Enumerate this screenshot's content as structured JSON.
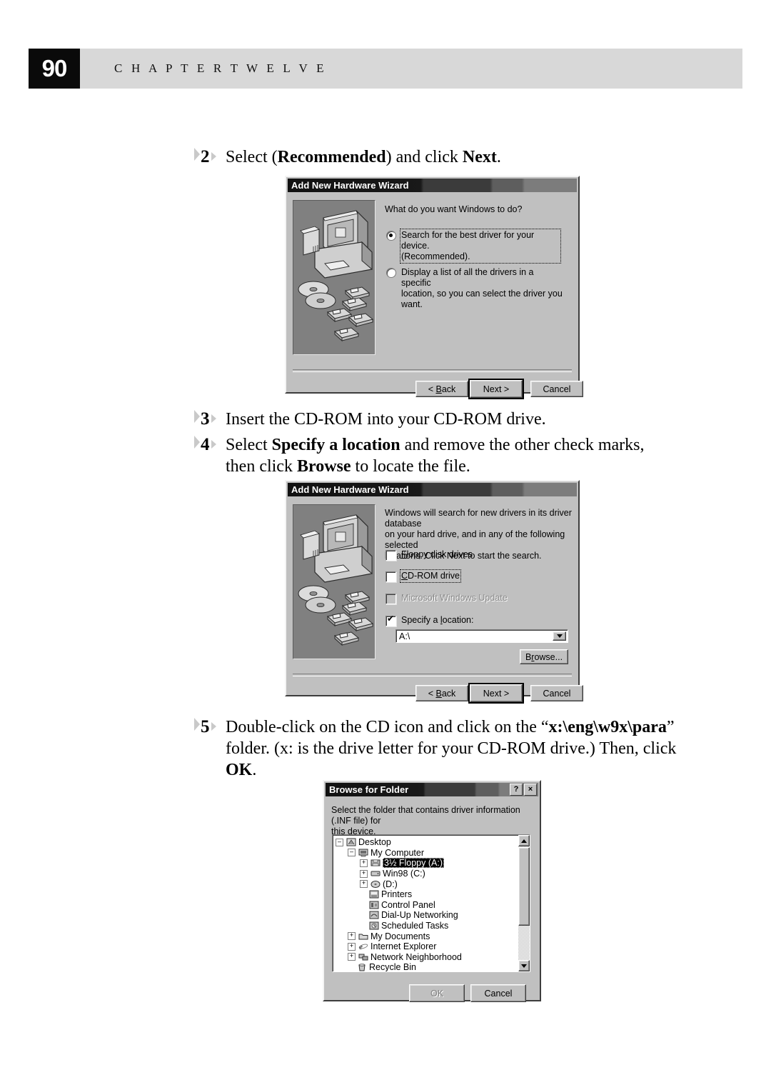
{
  "header": {
    "page_number": "90",
    "chapter": "C H A P T E R   T W E L V E"
  },
  "steps": [
    {
      "number": "2",
      "html": "Select (<b>Recommended</b>) and click <b>Next</b>."
    },
    {
      "number": "3",
      "html": "Insert the CD-ROM into your CD-ROM drive."
    },
    {
      "number": "4",
      "html": "Select <b>Specify a location</b> and remove the other check marks, then click <b>Browse</b> to locate the file."
    },
    {
      "number": "5",
      "html": "Double-click on the CD icon and click on the &ldquo;<b>x:\\eng\\w9x\\para</b>&rdquo; folder. (x: is the drive letter for your CD-ROM drive.) Then, click <b>OK</b>."
    }
  ],
  "dialog1": {
    "title": "Add New Hardware Wizard",
    "prompt": "What do you want Windows to do?",
    "options": [
      {
        "label_line1": "Search for the best driver for your device.",
        "label_line2": "(Recommended).",
        "selected": true,
        "focused": true
      },
      {
        "label_line1": "Display a list of all the drivers in a specific",
        "label_line2": "location, so you can select the driver you want.",
        "selected": false,
        "focused": false
      }
    ],
    "buttons": {
      "back": "< Back",
      "next": "Next >",
      "cancel": "Cancel"
    }
  },
  "dialog2": {
    "title": "Add New Hardware Wizard",
    "prompt_line1": "Windows will search for new drivers in its driver database",
    "prompt_line2": "on your hard drive, and in any of the following selected",
    "prompt_line3": "locations. Click Next to start the search.",
    "checkboxes": [
      {
        "label": "Floppy disk drives",
        "checked": false,
        "disabled": false,
        "focused": false
      },
      {
        "label": "CD-ROM drive",
        "checked": false,
        "disabled": false,
        "focused": true
      },
      {
        "label": "Microsoft Windows Update",
        "checked": false,
        "disabled": true,
        "focused": false
      },
      {
        "label": "Specify a location:",
        "checked": true,
        "disabled": false,
        "focused": false
      }
    ],
    "location_value": "A:\\",
    "browse_label": "Browse...",
    "buttons": {
      "back": "< Back",
      "next": "Next >",
      "cancel": "Cancel"
    }
  },
  "dialog3": {
    "title": "Browse for Folder",
    "help_button": "?",
    "close_button": "×",
    "prompt_line1": "Select the folder that contains driver information (.INF file) for",
    "prompt_line2": "this device.",
    "tree": [
      {
        "label": "Desktop",
        "depth": 0,
        "expander": "-",
        "icon": "desktop-icon",
        "selected": false
      },
      {
        "label": "My Computer",
        "depth": 1,
        "expander": "-",
        "icon": "computer-icon",
        "selected": false
      },
      {
        "label": "3½ Floppy (A:)",
        "depth": 2,
        "expander": "+",
        "icon": "floppy-icon",
        "selected": true
      },
      {
        "label": "Win98 (C:)",
        "depth": 2,
        "expander": "+",
        "icon": "harddisk-icon",
        "selected": false
      },
      {
        "label": "(D:)",
        "depth": 2,
        "expander": "+",
        "icon": "cdrom-icon",
        "selected": false
      },
      {
        "label": "Printers",
        "depth": 2,
        "expander": "",
        "icon": "printer-icon",
        "selected": false
      },
      {
        "label": "Control Panel",
        "depth": 2,
        "expander": "",
        "icon": "controlpanel-icon",
        "selected": false
      },
      {
        "label": "Dial-Up Networking",
        "depth": 2,
        "expander": "",
        "icon": "dialup-icon",
        "selected": false
      },
      {
        "label": "Scheduled Tasks",
        "depth": 2,
        "expander": "",
        "icon": "tasks-icon",
        "selected": false
      },
      {
        "label": "My Documents",
        "depth": 1,
        "expander": "+",
        "icon": "folder-icon",
        "selected": false
      },
      {
        "label": "Internet Explorer",
        "depth": 1,
        "expander": "+",
        "icon": "ie-icon",
        "selected": false
      },
      {
        "label": "Network Neighborhood",
        "depth": 1,
        "expander": "+",
        "icon": "network-icon",
        "selected": false
      },
      {
        "label": "Recycle Bin",
        "depth": 1,
        "expander": "",
        "icon": "recyclebin-icon",
        "selected": false
      }
    ],
    "buttons": {
      "ok": "OK",
      "cancel": "Cancel"
    }
  },
  "colors": {
    "page_bg": "#ffffff",
    "header_bar": "#d8d8d8",
    "page_num_bg": "#0a0a0a",
    "dialog_face": "#c0c0c0",
    "illustration_bg": "#808080",
    "titlebar_dark": "#111111"
  }
}
